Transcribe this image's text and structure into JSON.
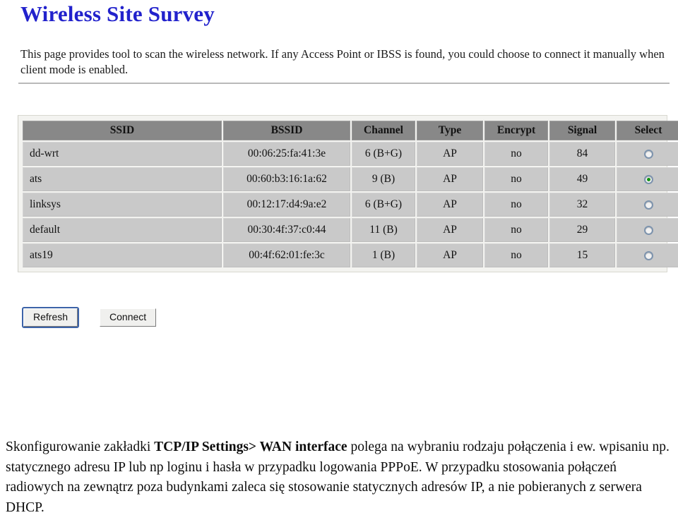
{
  "page": {
    "title": "Wireless Site Survey",
    "intro": "This page provides tool to scan the wireless network. If any Access Point or IBSS is found, you could choose to connect it manually when client mode is enabled."
  },
  "scan_table": {
    "columns": [
      "SSID",
      "BSSID",
      "Channel",
      "Type",
      "Encrypt",
      "Signal",
      "Select"
    ],
    "rows": [
      {
        "ssid": "dd-wrt",
        "bssid": "00:06:25:fa:41:3e",
        "channel": "6 (B+G)",
        "type": "AP",
        "encrypt": "no",
        "signal": "84",
        "selected": false
      },
      {
        "ssid": "ats",
        "bssid": "00:60:b3:16:1a:62",
        "channel": "9 (B)",
        "type": "AP",
        "encrypt": "no",
        "signal": "49",
        "selected": true
      },
      {
        "ssid": "linksys",
        "bssid": "00:12:17:d4:9a:e2",
        "channel": "6 (B+G)",
        "type": "AP",
        "encrypt": "no",
        "signal": "32",
        "selected": false
      },
      {
        "ssid": "default",
        "bssid": "00:30:4f:37:c0:44",
        "channel": "11 (B)",
        "type": "AP",
        "encrypt": "no",
        "signal": "29",
        "selected": false
      },
      {
        "ssid": "ats19",
        "bssid": "00:4f:62:01:fe:3c",
        "channel": "1 (B)",
        "type": "AP",
        "encrypt": "no",
        "signal": "15",
        "selected": false
      }
    ]
  },
  "buttons": {
    "refresh": "Refresh",
    "connect": "Connect"
  },
  "commentary": {
    "part1": "Skonfigurowanie zakładki ",
    "bold1": "TCP/IP Settings> WAN interface",
    "part2": " polega na wybraniu rodzaju połączenia i ew. wpisaniu np.  statycznego adresu IP lub np loginu i hasła w przypadku logowania PPPoE. W przypadku stosowania połączeń radiowych na zewnątrz poza budynkami zaleca się stosowanie statycznych adresów IP, a nie pobieranych z serwera DHCP."
  },
  "colors": {
    "title": "#2222cc",
    "table_header_bg": "#888888",
    "table_cell_bg": "#c9c9c9",
    "radio_selected_dot": "#139313",
    "button_focus": "#3c63a8"
  }
}
